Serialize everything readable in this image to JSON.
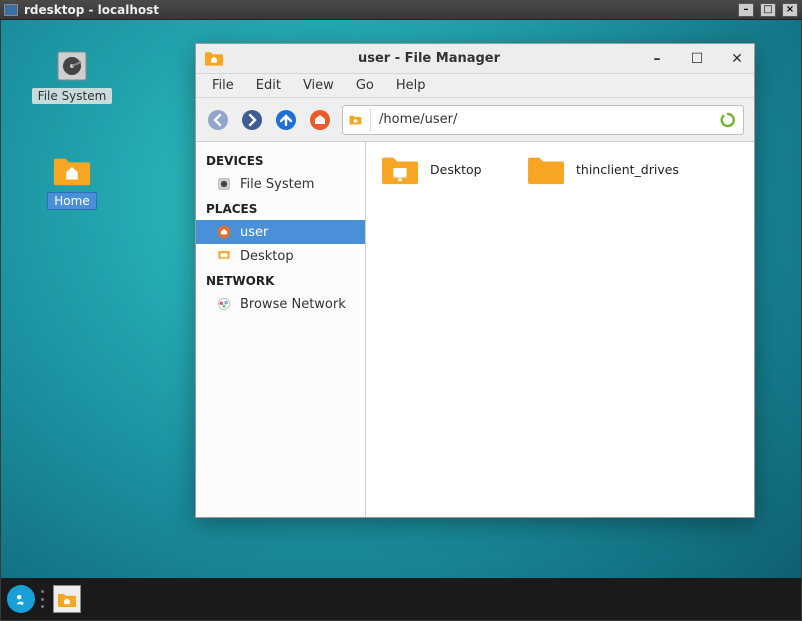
{
  "host": {
    "title": "rdesktop - localhost"
  },
  "desktop_icons": {
    "file_system": "File System",
    "home": "Home"
  },
  "fm": {
    "title": "user - File Manager",
    "menu": {
      "file": "File",
      "edit": "Edit",
      "view": "View",
      "go": "Go",
      "help": "Help"
    },
    "path": "/home/user/",
    "sidebar": {
      "devices_head": "DEVICES",
      "places_head": "PLACES",
      "network_head": "NETWORK",
      "file_system": "File System",
      "user": "user",
      "desktop": "Desktop",
      "browse_network": "Browse Network"
    },
    "items": {
      "desktop": "Desktop",
      "thinclient": "thinclient_drives"
    }
  },
  "colors": {
    "accent": "#4a90d9",
    "folder": "#f6a623"
  }
}
